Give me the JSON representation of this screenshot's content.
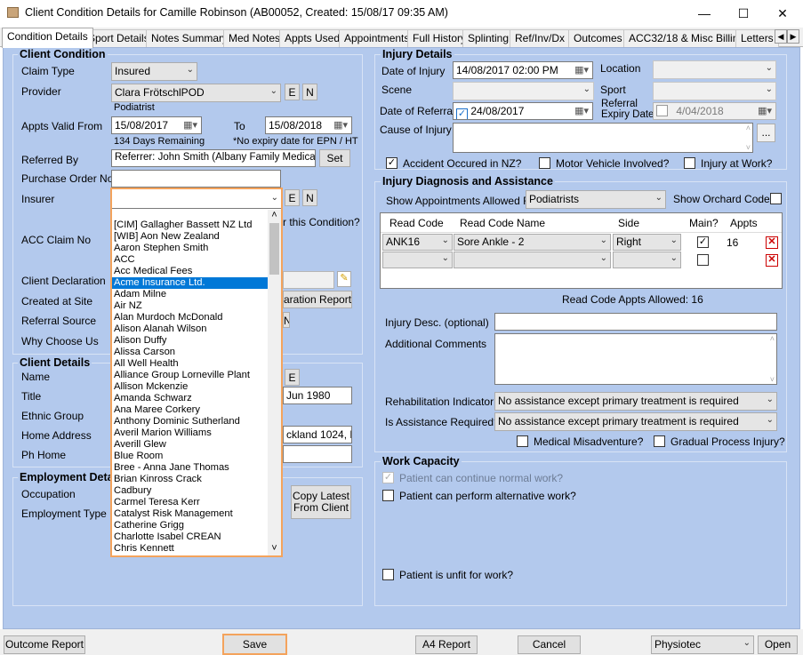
{
  "window": {
    "title": "Client Condition Details for Camille Robinson (AB00052, Created: 15/08/17 09:35 AM)",
    "minimize": "—",
    "maximize": "☐",
    "close": "✕"
  },
  "tabs": [
    "Condition Details",
    "Sport Details",
    "Notes Summary",
    "Med Notes",
    "Appts Used",
    "Appointments",
    "Full History",
    "Splinting",
    "Ref/Inv/Dx",
    "Outcomes",
    "ACC32/18 & Misc Billing",
    "Letters"
  ],
  "client_condition": {
    "title": "Client Condition",
    "claim_type_label": "Claim Type",
    "claim_type_value": "Insured",
    "provider_label": "Provider",
    "provider_value": "Clara FrötschlPOD",
    "provider_role": "Podiatrist",
    "e_btn": "E",
    "n_btn": "N",
    "appts_valid_from_label": "Appts Valid From",
    "appts_valid_from": "15/08/2017",
    "to_label": "To",
    "appts_valid_to": "15/08/2018",
    "days_remaining": "134 Days Remaining",
    "no_expiry_note": "*No expiry date for EPN / HT",
    "referred_by_label": "Referred By",
    "referred_by_value": "Referrer: John Smith (Albany Family Medical Cer",
    "set_btn": "Set",
    "purchase_order_label": "Purchase Order No",
    "insurer_label": "Insurer",
    "acc_claim_label": "ACC Claim No",
    "this_condition_text": "r this Condition?",
    "client_declaration_label": "Client Declaration",
    "created_at_site_label": "Created at Site",
    "declaration_report_btn": "aration Report",
    "referral_source_label": "Referral Source",
    "why_choose_label": "Why Choose Us",
    "n_partial": "N"
  },
  "insurer_list": {
    "items": [
      "[CIM] Gallagher Bassett NZ Ltd",
      "[WIB] Aon New Zealand",
      "Aaron Stephen Smith",
      "ACC",
      "Acc Medical Fees",
      "Acme Insurance Ltd.",
      "Adam Milne",
      "Air NZ",
      "Alan Murdoch  McDonald",
      "Alison Alanah Wilson",
      "Alison Duffy",
      "Alissa Carson",
      "All Well Health",
      "Alliance Group Lorneville Plant",
      "Allison Mckenzie",
      "Amanda Schwarz",
      "Ana Maree Corkery",
      "Anthony Dominic Sutherland",
      "Averil Marion Williams",
      "Averill Glew",
      "Blue Room",
      "Bree - Anna Jane Thomas",
      "Brian Kinross Crack",
      "Cadbury",
      "Carmel Teresa Kerr",
      "Catalyst Risk Management",
      "Catherine Grigg",
      "Charlotte Isabel CREAN",
      "Chris Kennett"
    ],
    "selected_index": 5,
    "scroll_up": "˄",
    "scroll_down": "˅"
  },
  "client_details": {
    "title": "Client Details",
    "name_label": "Name",
    "e_btn": "E",
    "title_label": "Title",
    "dob_partial": "Jun 1980",
    "ethnic_group_label": "Ethnic Group",
    "home_address_label": "Home Address",
    "address_partial": "ckland 1024, Ne",
    "ph_home_label": "Ph Home"
  },
  "employment": {
    "title": "Employment Detai",
    "occupation_label": "Occupation",
    "employment_type_label": "Employment Type",
    "copy_latest_btn_line1": "Copy Latest",
    "copy_latest_btn_line2": "From Client"
  },
  "injury_details": {
    "title": "Injury Details",
    "date_of_injury_label": "Date of Injury",
    "date_of_injury": "14/08/2017 02:00 PM",
    "location_label": "Location",
    "scene_label": "Scene",
    "sport_label": "Sport",
    "date_of_referral_label": "Date of Referral",
    "date_of_referral": "24/08/2017",
    "referral_expiry_label1": "Referral",
    "referral_expiry_label2": "Expiry Date",
    "referral_expiry": "4/04/2018",
    "cause_label": "Cause of Injury",
    "ellipsis_btn": "...",
    "accident_nz": "Accident Occured in NZ?",
    "motor_vehicle": "Motor Vehicle Involved?",
    "injury_at_work": "Injury at Work?"
  },
  "diagnosis": {
    "title": "Injury Diagnosis and Assistance",
    "show_appts_label": "Show Appointments Allowed For",
    "show_appts_value": "Podiatrists",
    "show_orchard_label": "Show Orchard Codes",
    "headers": [
      "Read Code",
      "Read Code Name",
      "Side",
      "Main?",
      "Appts"
    ],
    "rows": [
      {
        "code": "ANK16",
        "name": "Sore Ankle - 2",
        "side": "Right",
        "main": "✓",
        "appts": "16"
      },
      {
        "code": "",
        "name": "",
        "side": "",
        "main": "",
        "appts": ""
      }
    ],
    "delete_icon": "✕",
    "read_code_allowed": "Read Code Appts Allowed: 16",
    "injury_desc_label": "Injury Desc. (optional)",
    "additional_comments_label": "Additional Comments",
    "rehab_label": "Rehabilitation Indicator",
    "rehab_value": "No assistance except primary treatment is required",
    "assistance_label": "Is Assistance Required?",
    "assistance_value": "No assistance except primary treatment is required",
    "medical_misadventure": "Medical Misadventure?",
    "gradual_process": "Gradual Process Injury?"
  },
  "work_capacity": {
    "title": "Work Capacity",
    "normal_work": "Patient can continue normal work?",
    "alternative_work": "Patient can perform alternative work?",
    "unfit_work": "Patient is unfit for work?"
  },
  "bottom": {
    "outcome_report": "Outcome Report",
    "save": "Save",
    "a4_report": "A4 Report",
    "cancel": "Cancel",
    "physiotec": "Physiotec",
    "open": "Open"
  },
  "colors": {
    "panel": "#b3c9ed",
    "selection": "#0078d7",
    "highlight_border": "#f4a35c",
    "delete_red": "#cc0000"
  }
}
